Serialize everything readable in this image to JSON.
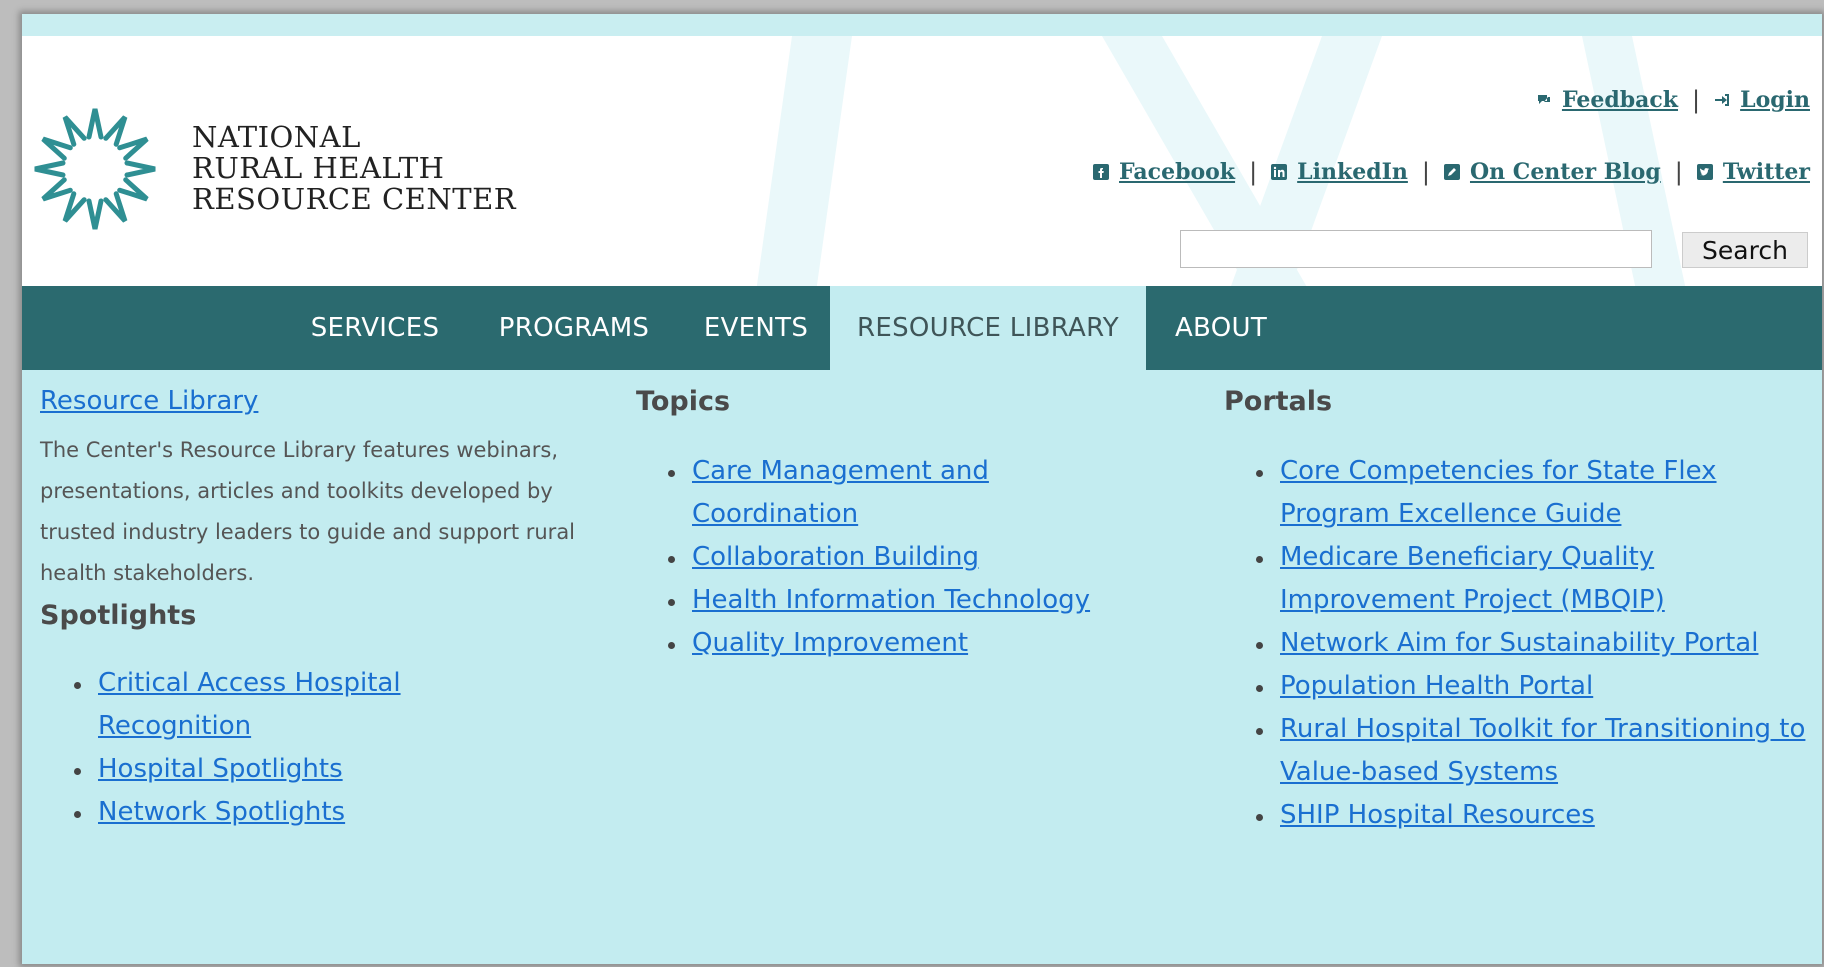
{
  "header": {
    "org_name_line1": "NATIONAL",
    "org_name_line2": "RURAL HEALTH",
    "org_name_line3": "RESOURCE CENTER",
    "utility_links": {
      "feedback": "Feedback",
      "login": "Login",
      "facebook": "Facebook",
      "linkedin": "LinkedIn",
      "blog": "On Center Blog",
      "twitter": "Twitter",
      "separator": "|"
    },
    "search": {
      "value": "",
      "button_label": "Search"
    }
  },
  "nav": {
    "items": [
      {
        "label": "SERVICES"
      },
      {
        "label": "PROGRAMS"
      },
      {
        "label": "EVENTS"
      },
      {
        "label": "RESOURCE LIBRARY",
        "active": true
      },
      {
        "label": "ABOUT"
      }
    ]
  },
  "menu": {
    "resource_library": {
      "title_link": "Resource Library",
      "description": "The Center's Resource Library features webinars, presentations, articles and toolkits developed by trusted industry leaders to guide and support rural health stakeholders."
    },
    "spotlights": {
      "title": "Spotlights",
      "items": [
        "Critical Access Hospital Recognition",
        "Hospital Spotlights",
        "Network Spotlights"
      ]
    },
    "topics": {
      "title": "Topics",
      "items": [
        "Care Management and Coordination",
        "Collaboration Building",
        "Health Information Technology",
        "Quality Improvement"
      ]
    },
    "portals": {
      "title": "Portals",
      "items": [
        "Core Competencies for State Flex Program Excellence Guide",
        "Medicare Beneficiary Quality Improvement Project (MBQIP)",
        "Network Aim for Sustainability Portal",
        "Population Health Portal",
        "Rural Hospital Toolkit for Transitioning to Value-based Systems",
        "SHIP Hospital Resources"
      ]
    }
  },
  "colors": {
    "nav_bg": "#2b6a6f",
    "menu_bg": "#c3ecf0",
    "link": "#1a6fd0",
    "utility_link": "#2a6870",
    "logo_teal": "#2f8f93"
  }
}
